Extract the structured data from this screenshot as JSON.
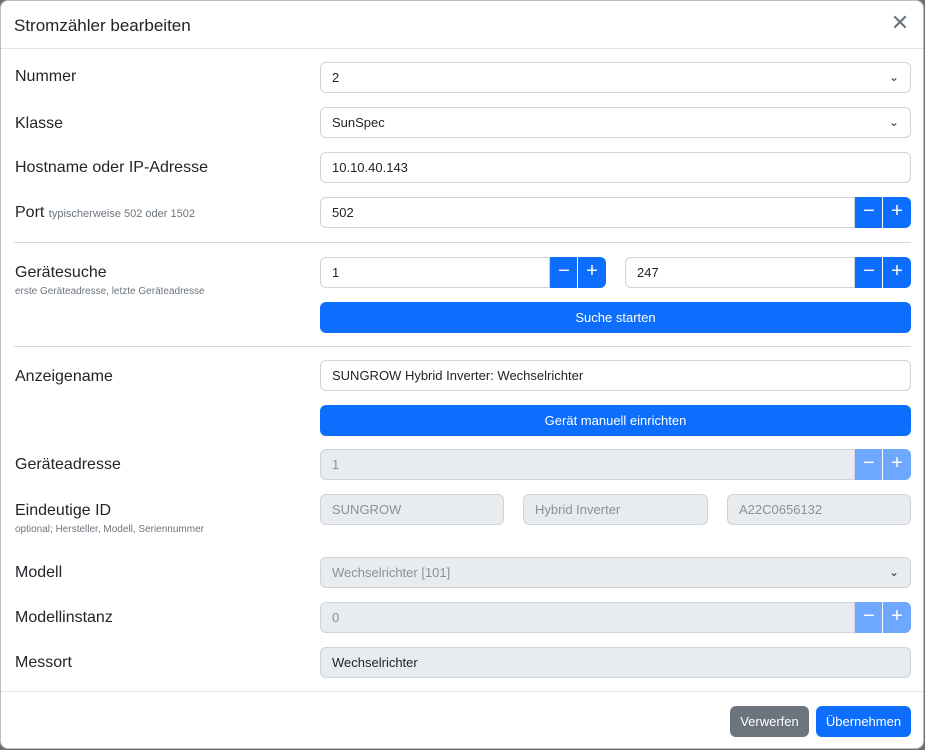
{
  "dialog": {
    "title": "Stromzähler bearbeiten",
    "close_glyph": "✕"
  },
  "nummer": {
    "label": "Nummer",
    "value": "2"
  },
  "klasse": {
    "label": "Klasse",
    "value": "SunSpec"
  },
  "hostname": {
    "label": "Hostname oder IP-Adresse",
    "value": "10.10.40.143"
  },
  "port": {
    "label": "Port",
    "hint": "typischerweise 502 oder 1502",
    "value": "502"
  },
  "geraetesuche": {
    "label": "Gerätesuche",
    "sub": "erste Geräteadresse, letzte Geräteadresse",
    "first_value": "1",
    "last_value": "247",
    "search_button": "Suche starten"
  },
  "anzeigename": {
    "label": "Anzeigename",
    "value": "SUNGROW Hybrid Inverter: Wechselrichter"
  },
  "manual_button": "Gerät manuell einrichten",
  "geraeteadresse": {
    "label": "Geräteadresse",
    "value": "1"
  },
  "eindeutige_id": {
    "label": "Eindeutige ID",
    "sub": "optional; Hersteller, Modell, Seriennummer",
    "hersteller": "SUNGROW",
    "modell": "Hybrid Inverter",
    "seriennummer": "A22C0656132"
  },
  "modell": {
    "label": "Modell",
    "value": "Wechselrichter [101]"
  },
  "modellinstanz": {
    "label": "Modellinstanz",
    "value": "0"
  },
  "messort": {
    "label": "Messort",
    "value": "Wechselrichter"
  },
  "stepper": {
    "minus": "−",
    "plus": "+"
  },
  "chevron_glyph": "⌄",
  "footer": {
    "discard": "Verwerfen",
    "apply": "Übernehmen"
  },
  "colors": {
    "primary": "#0d6efd",
    "primary_disabled": "#6ea8fe",
    "secondary": "#6c757d",
    "disabled_bg": "#e9ecef"
  }
}
